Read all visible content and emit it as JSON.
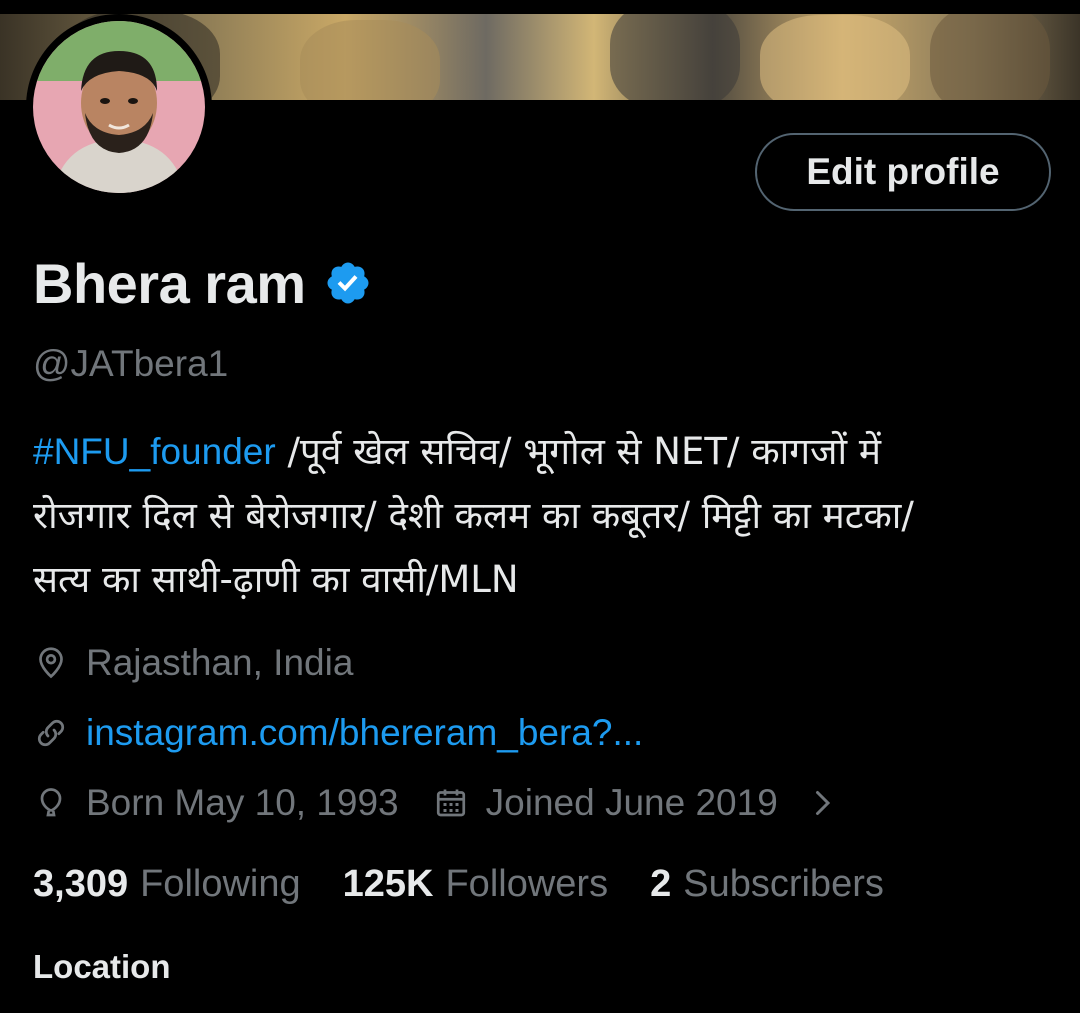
{
  "profile": {
    "edit_button": "Edit profile",
    "name": "Bhera ram",
    "verified": true,
    "handle": "@JATbera1",
    "bio": {
      "hashtag": "#NFU_founder",
      "line1": " /पूर्व खेल सचिव/ भूगोल से NET/ कागजों में",
      "line2": "रोजगार दिल से बेरोजगार/ देशी कलम का कबूतर/  मिट्टी का मटका/",
      "line3": "सत्य का साथी-ढ़ाणी का वासी/MLN"
    },
    "location": "Rajasthan, India",
    "link": "instagram.com/bhereram_bera?...",
    "born": "Born May 10, 1993",
    "joined": "Joined June 2019",
    "stats": {
      "following_count": "3,309",
      "following_label": "Following",
      "followers_count": "125K",
      "followers_label": "Followers",
      "subscribers_count": "2",
      "subscribers_label": "Subscribers"
    },
    "section_label": "Location"
  },
  "colors": {
    "background": "#000000",
    "text_primary": "#e7e9ea",
    "text_secondary": "#71767b",
    "accent": "#1d9bf0",
    "button_border": "#536471"
  },
  "icons": [
    "location-pin-icon",
    "link-icon",
    "birthday-balloon-icon",
    "calendar-icon",
    "chevron-right-icon",
    "verified-badge-icon"
  ]
}
